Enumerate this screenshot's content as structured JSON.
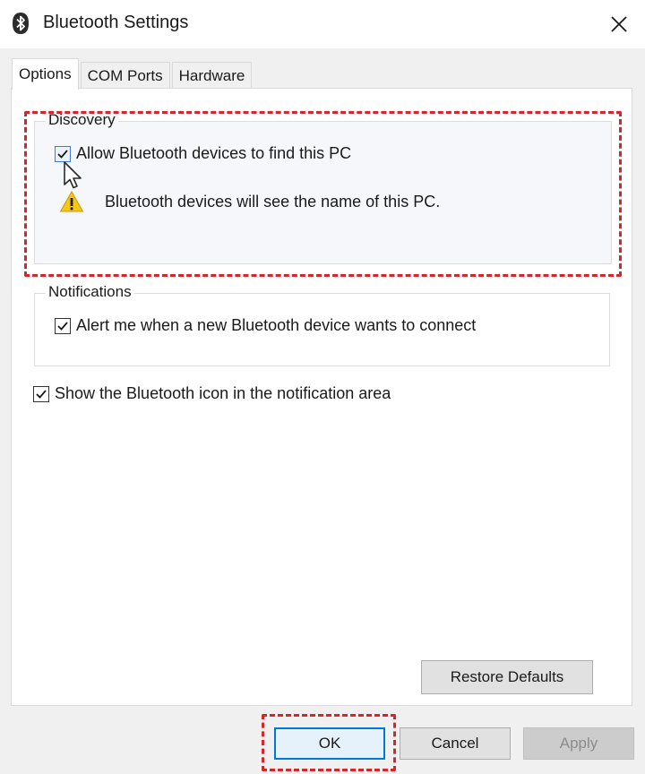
{
  "window": {
    "title": "Bluetooth Settings",
    "icon": "bluetooth-icon",
    "close_icon": "close-icon"
  },
  "tabs": [
    {
      "label": "Options",
      "active": true
    },
    {
      "label": "COM Ports",
      "active": false
    },
    {
      "label": "Hardware",
      "active": false
    }
  ],
  "discovery": {
    "legend": "Discovery",
    "allow_label": "Allow Bluetooth devices to find this PC",
    "allow_checked": true,
    "warning_text": "Bluetooth devices will see the name of this PC.",
    "warning_icon": "warning-icon"
  },
  "notifications": {
    "legend": "Notifications",
    "alert_label": "Alert me when a new Bluetooth device wants to connect",
    "alert_checked": true
  },
  "show_icon": {
    "label": "Show the Bluetooth icon in the notification area",
    "checked": true
  },
  "buttons": {
    "restore": "Restore Defaults",
    "ok": "OK",
    "cancel": "Cancel",
    "apply": "Apply"
  },
  "colors": {
    "highlight": "#d6262b",
    "default_button_border": "#0078d7"
  }
}
